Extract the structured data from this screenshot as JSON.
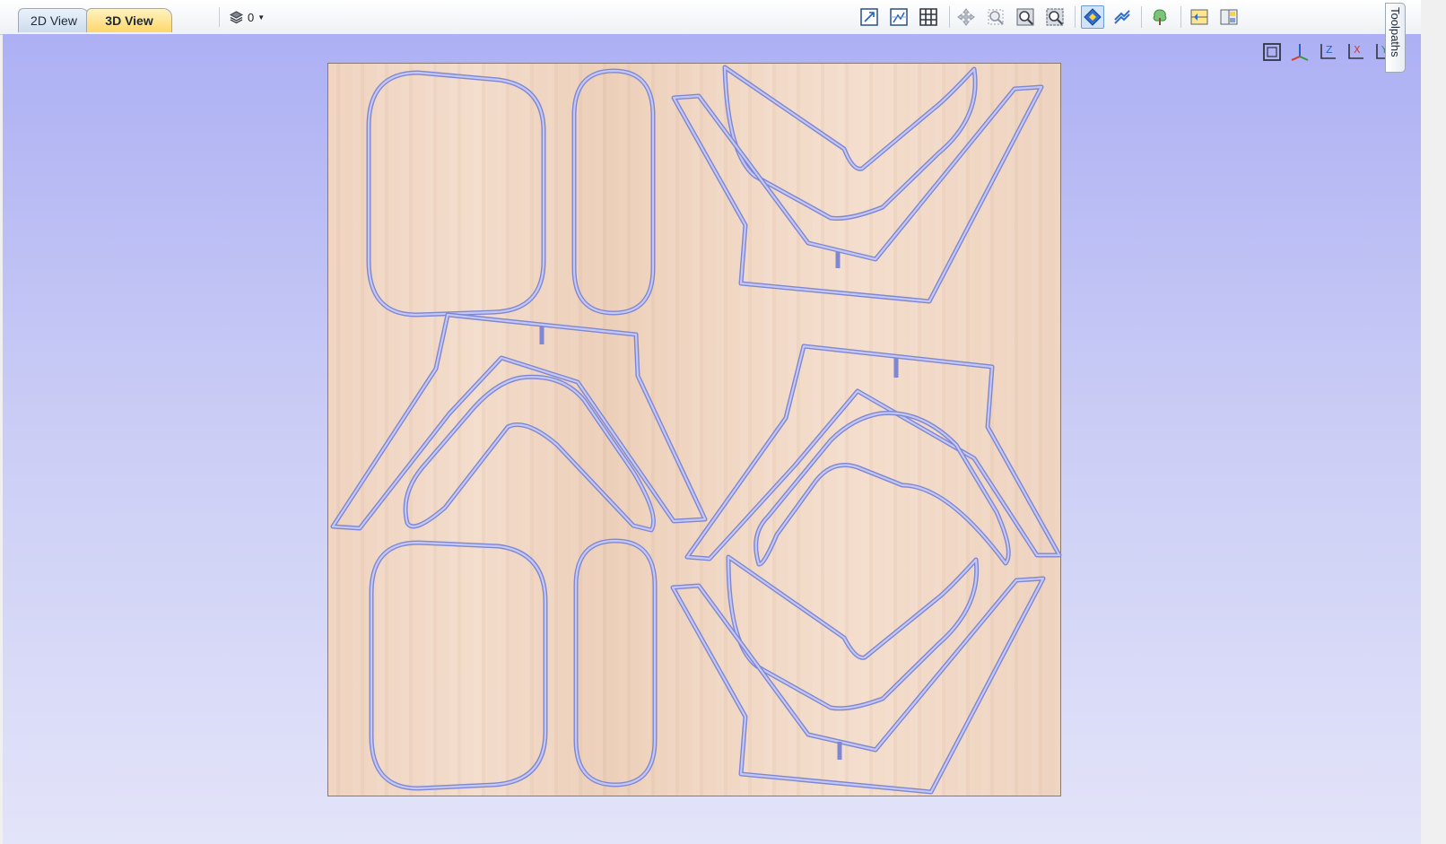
{
  "tabs": [
    {
      "label": "2D View",
      "active": false
    },
    {
      "label": "3D View",
      "active": true
    }
  ],
  "layer_selector": {
    "value": "0",
    "icon": "layer-stack-icon"
  },
  "toolbar_icons": [
    "zoom-extents-icon",
    "show-material-icon",
    "grid-icon",
    "pan-icon",
    "zoom-box-icon",
    "zoom-in-icon",
    "zoom-out-icon",
    "toolpath-preview-icon",
    "toolpath-lines-icon",
    "tree-render-icon",
    "split-view-icon",
    "tile-view-icon"
  ],
  "orientation_buttons": [
    "iso-view-icon",
    "view-z-icon",
    "view-z-top-icon",
    "view-x-icon",
    "view-y-icon"
  ],
  "side_panel": {
    "label": "Toolpaths"
  },
  "colors": {
    "viewport_top": "#adb0f4",
    "viewport_bottom": "#e3e4f9",
    "material": "#f0d5c2",
    "cut_path": "#a9aee6",
    "active_tab": "#ffd76a"
  }
}
